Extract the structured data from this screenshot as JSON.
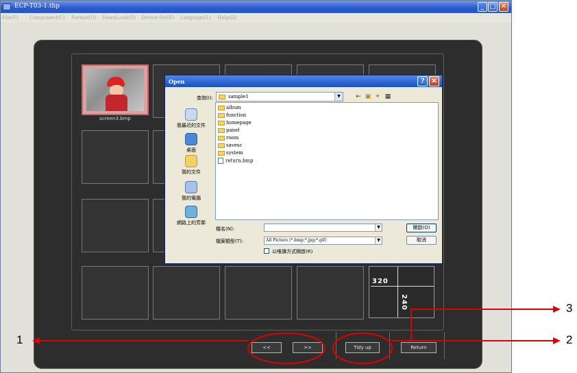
{
  "window": {
    "title": "ECP-T03-1.thp",
    "caption_buttons": [
      "_",
      "□",
      "✕"
    ]
  },
  "menu": [
    "File(F)",
    "Component(C)",
    "Format(O)",
    "DownLoad(D)",
    "Device-Set(E)",
    "Language(L)",
    "Help(H)"
  ],
  "gallery": {
    "thumbnail_label": "screen3.bmp",
    "size_width": "320",
    "size_height": "240"
  },
  "bottom_bar": {
    "prev_label": "<<",
    "next_label": ">>",
    "tidy_label": "Tidy up",
    "return_label": "Return"
  },
  "dialog": {
    "title": "Open",
    "look_in_label": "查詢(I):",
    "look_in_value": "sample1",
    "places": [
      "我最近的文件",
      "桌面",
      "我的文件",
      "我的電腦",
      "網路上的芳鄰"
    ],
    "files": [
      {
        "name": "album",
        "type": "folder"
      },
      {
        "name": "function",
        "type": "folder"
      },
      {
        "name": "homepage",
        "type": "folder"
      },
      {
        "name": "panel",
        "type": "folder"
      },
      {
        "name": "room",
        "type": "folder"
      },
      {
        "name": "savesc",
        "type": "folder"
      },
      {
        "name": "system",
        "type": "folder"
      },
      {
        "name": "return.bmp",
        "type": "bmp"
      }
    ],
    "filename_label": "檔名(N):",
    "filename_value": "",
    "filetype_label": "檔案類型(T):",
    "filetype_value": "All Picture (*.bmp;*.jpg;*.gif)",
    "readonly_label": "以唯讀方式開啟(R)",
    "open_button": "開啟(O)",
    "cancel_button": "取消"
  },
  "callouts": [
    "1",
    "2",
    "3"
  ],
  "colors": {
    "title_blue": "#2556c8",
    "stage_dark": "#2d2d2d",
    "callout_red": "#e00000"
  }
}
